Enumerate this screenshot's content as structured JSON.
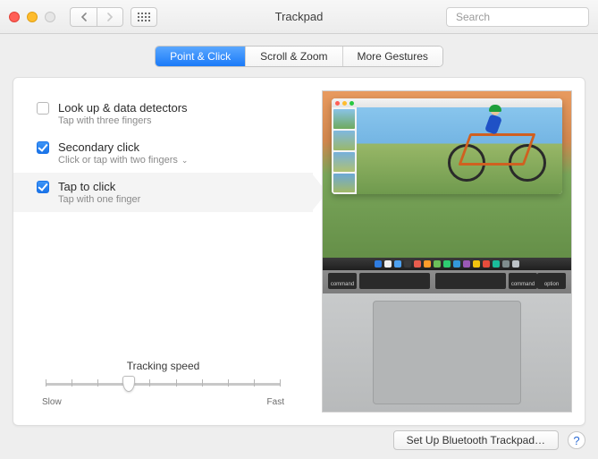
{
  "window": {
    "title": "Trackpad"
  },
  "search": {
    "placeholder": "Search"
  },
  "tabs": [
    {
      "label": "Point & Click",
      "active": true
    },
    {
      "label": "Scroll & Zoom",
      "active": false
    },
    {
      "label": "More Gestures",
      "active": false
    }
  ],
  "options": [
    {
      "title": "Look up & data detectors",
      "subtitle": "Tap with three fingers",
      "checked": false,
      "dropdown": false,
      "selected": false
    },
    {
      "title": "Secondary click",
      "subtitle": "Click or tap with two fingers",
      "checked": true,
      "dropdown": true,
      "selected": false
    },
    {
      "title": "Tap to click",
      "subtitle": "Tap with one finger",
      "checked": true,
      "dropdown": false,
      "selected": true
    }
  ],
  "tracking": {
    "label": "Tracking speed",
    "min_label": "Slow",
    "max_label": "Fast",
    "ticks": 10,
    "value_index": 3
  },
  "action_button": "Set Up Bluetooth Trackpad…",
  "help_label": "?",
  "preview": {
    "keys": [
      "command",
      "",
      "",
      "command",
      "option"
    ],
    "dock_colors": [
      "#2f7de1",
      "#f0f0f0",
      "#4ea1f0",
      "#3a3a3a",
      "#e85d4e",
      "#ff9c2a",
      "#6bbf59",
      "#2ecc71",
      "#3498db",
      "#9b59b6",
      "#f1c40f",
      "#e74c3c",
      "#1abc9c",
      "#7f8c8d",
      "#bdc3c7"
    ]
  }
}
